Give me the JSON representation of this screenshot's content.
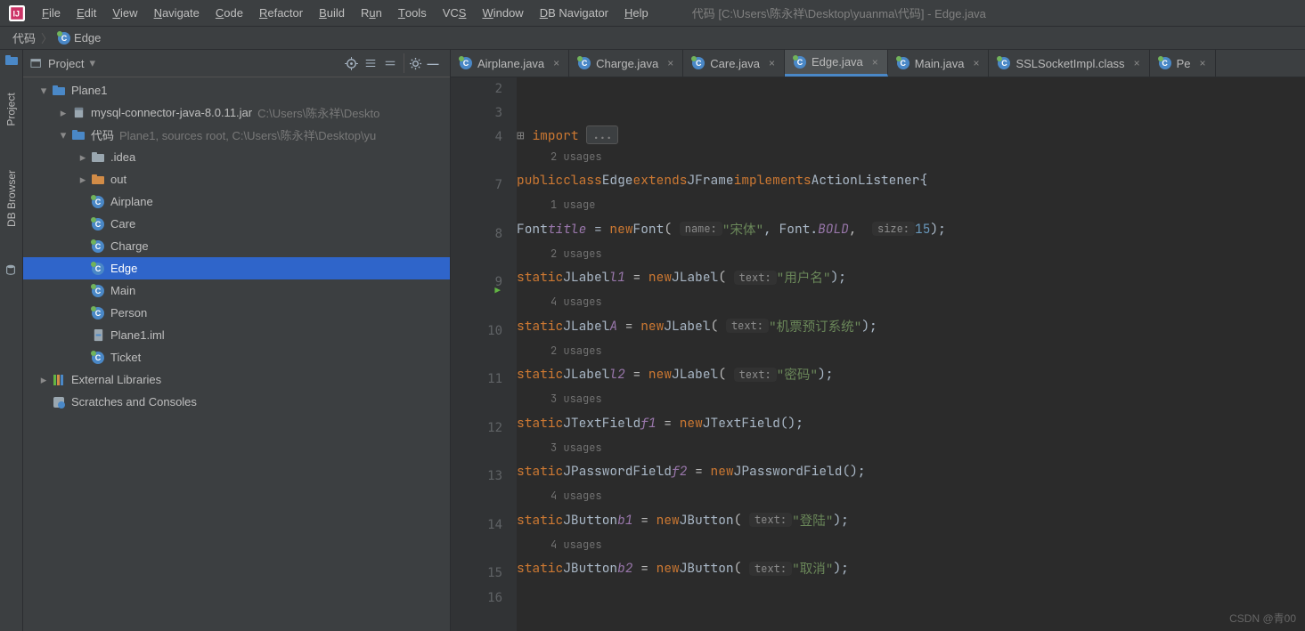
{
  "window_title": "代码 [C:\\Users\\陈永祥\\Desktop\\yuanma\\代码] - Edge.java",
  "menu": [
    "File",
    "Edit",
    "View",
    "Navigate",
    "Code",
    "Refactor",
    "Build",
    "Run",
    "Tools",
    "VCS",
    "Window",
    "DB Navigator",
    "Help"
  ],
  "breadcrumb": {
    "root": "代码",
    "current": "Edge"
  },
  "project_panel": {
    "title": "Project",
    "toolbar_icons": [
      "target",
      "expand",
      "collapse",
      "settings",
      "hide"
    ]
  },
  "tree": [
    {
      "depth": 0,
      "tw": "v",
      "icon": "module",
      "label": "Plane1",
      "dim": "",
      "sel": false
    },
    {
      "depth": 1,
      "tw": ">",
      "icon": "jar",
      "label": "mysql-connector-java-8.0.11.jar",
      "dim": "C:\\Users\\陈永祥\\Deskto",
      "sel": false
    },
    {
      "depth": 1,
      "tw": "v",
      "icon": "src",
      "label": "代码",
      "dim": "Plane1, sources root, C:\\Users\\陈永祥\\Desktop\\yu",
      "sel": false
    },
    {
      "depth": 2,
      "tw": ">",
      "icon": "folder",
      "label": ".idea",
      "dim": "",
      "sel": false
    },
    {
      "depth": 2,
      "tw": ">",
      "icon": "folder-orange",
      "label": "out",
      "dim": "",
      "sel": false
    },
    {
      "depth": 2,
      "tw": "",
      "icon": "class",
      "label": "Airplane",
      "dim": "",
      "sel": false
    },
    {
      "depth": 2,
      "tw": "",
      "icon": "class",
      "label": "Care",
      "dim": "",
      "sel": false
    },
    {
      "depth": 2,
      "tw": "",
      "icon": "class",
      "label": "Charge",
      "dim": "",
      "sel": false
    },
    {
      "depth": 2,
      "tw": "",
      "icon": "class",
      "label": "Edge",
      "dim": "",
      "sel": true
    },
    {
      "depth": 2,
      "tw": "",
      "icon": "class",
      "label": "Main",
      "dim": "",
      "sel": false
    },
    {
      "depth": 2,
      "tw": "",
      "icon": "class",
      "label": "Person",
      "dim": "",
      "sel": false
    },
    {
      "depth": 2,
      "tw": "",
      "icon": "iml",
      "label": "Plane1.iml",
      "dim": "",
      "sel": false
    },
    {
      "depth": 2,
      "tw": "",
      "icon": "class",
      "label": "Ticket",
      "dim": "",
      "sel": false
    },
    {
      "depth": 0,
      "tw": ">",
      "icon": "libs",
      "label": "External Libraries",
      "dim": "",
      "sel": false
    },
    {
      "depth": 0,
      "tw": "",
      "icon": "scratch",
      "label": "Scratches and Consoles",
      "dim": "",
      "sel": false
    }
  ],
  "tabs": [
    {
      "label": "Airplane.java",
      "active": false,
      "icon": "class"
    },
    {
      "label": "Charge.java",
      "active": false,
      "icon": "class"
    },
    {
      "label": "Care.java",
      "active": false,
      "icon": "class"
    },
    {
      "label": "Edge.java",
      "active": true,
      "icon": "class"
    },
    {
      "label": "Main.java",
      "active": false,
      "icon": "class"
    },
    {
      "label": "SSLSocketImpl.class",
      "active": false,
      "icon": "class"
    },
    {
      "label": "Pe",
      "active": false,
      "icon": "class"
    }
  ],
  "gutter_lines": [
    "2",
    "3",
    "4",
    "",
    "7",
    "",
    "8",
    "",
    "9",
    "",
    "10",
    "",
    "11",
    "",
    "12",
    "",
    "13",
    "",
    "14",
    "",
    "15",
    "16"
  ],
  "code": {
    "import_kw": "import",
    "import_fold": "...",
    "usages_2": "2 usages",
    "usage_1": "1 usage",
    "usages_4": "4 usages",
    "usages_3": "3 usages",
    "line7": {
      "public": "public",
      "class": "class",
      "Edge": "Edge",
      "extends": "extends",
      "JFrame": "JFrame",
      "implements": "implements",
      "AL": "ActionListener",
      "brace": "{"
    },
    "line8": {
      "Font": "Font",
      "title": "title",
      "eq": " = ",
      "new": "new",
      "Font2": "Font",
      "name": "name:",
      "str": "\"宋体\"",
      "comma": ", ",
      "FontB": "Font.",
      "BOLD": "BOLD",
      "size": "size:",
      "num": "15",
      "end": ");"
    },
    "line9": {
      "static": "static",
      "JLabel": "JLabel",
      "v": "l1",
      "new": "new",
      "text": "text:",
      "str": "\"用户名\"",
      "end": ");"
    },
    "line10": {
      "static": "static",
      "JLabel": "JLabel",
      "v": "A",
      "new": "new",
      "text": "text:",
      "str": "\"机票预订系统\"",
      "end": ");"
    },
    "line11": {
      "static": "static",
      "JLabel": "JLabel",
      "v": "l2",
      "new": "new",
      "text": "text:",
      "str": "\"密码\"",
      "end": ");"
    },
    "line12": {
      "static": "static",
      "JTF": "JTextField",
      "v": "f1",
      "new": "new",
      "JTF2": "JTextField",
      "end": "();"
    },
    "line13": {
      "static": "static",
      "JPF": "JPasswordField",
      "v": "f2",
      "new": "new",
      "JPF2": "JPasswordField",
      "end": "();"
    },
    "line14": {
      "static": "static",
      "JB": "JButton",
      "v": "b1",
      "new": "new",
      "JB2": "JButton",
      "text": "text:",
      "str": "\"登陆\"",
      "end": ");"
    },
    "line15": {
      "static": "static",
      "JB": "JButton",
      "v": "b2",
      "new": "new",
      "JB2": "JButton",
      "text": "text:",
      "str": "\"取消\"",
      "end": ");"
    }
  },
  "watermark": "CSDN @青00",
  "left_tabs": {
    "project": "Project",
    "db": "DB Browser"
  }
}
